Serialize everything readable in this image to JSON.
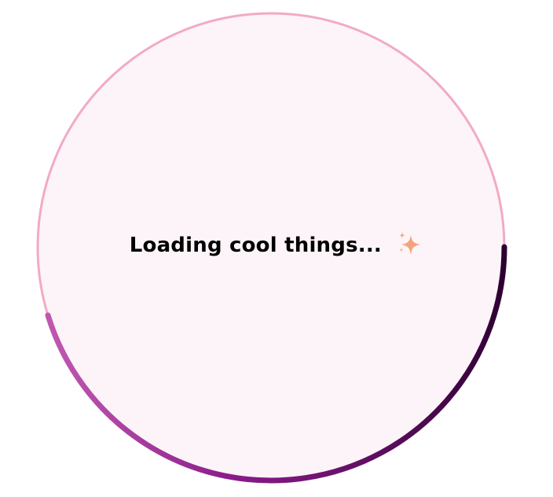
{
  "loader": {
    "message": "Loading cool things...",
    "icon": "sparkles-icon",
    "colors": {
      "ring_track": "#f2aac6",
      "fill": "#fcf4f8",
      "arc_start": "#c057b0",
      "arc_mid": "#8a1b8a",
      "arc_end": "#2c0030",
      "sparkle": "#f5a37d"
    }
  }
}
